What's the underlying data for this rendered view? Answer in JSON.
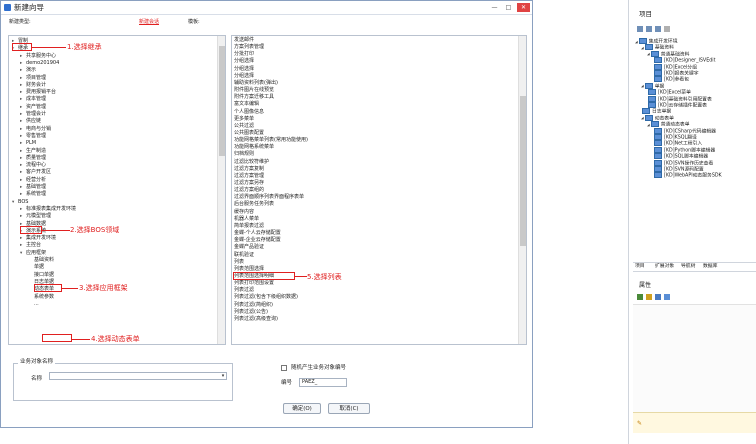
{
  "dialog": {
    "title": "新建向导",
    "create_type_label": "新建类型:",
    "tag": "新建会话",
    "template_label": "模板:"
  },
  "tree": [
    {
      "label": "冒制",
      "toggle": "▸"
    },
    {
      "label": "继承",
      "toggle": "▸"
    },
    {
      "label": "共享服务中心",
      "toggle": "▸"
    },
    {
      "label": "demo201904",
      "toggle": "▸"
    },
    {
      "label": "演示",
      "toggle": "▸"
    },
    {
      "label": "项目管理",
      "toggle": "▸"
    },
    {
      "label": "财务会计",
      "toggle": "▸"
    },
    {
      "label": "费用报销平台",
      "toggle": "▸"
    },
    {
      "label": "成本管理",
      "toggle": "▸"
    },
    {
      "label": "资产管理",
      "toggle": "▸"
    },
    {
      "label": "管理会计",
      "toggle": "▸"
    },
    {
      "label": "供应链",
      "toggle": "▸"
    },
    {
      "label": "电商与分销",
      "toggle": "▸"
    },
    {
      "label": "零售管理",
      "toggle": "▸"
    },
    {
      "label": "PLM",
      "toggle": "▸"
    },
    {
      "label": "生产制造",
      "toggle": "▸"
    },
    {
      "label": "质量管理",
      "toggle": "▸"
    },
    {
      "label": "流程中心",
      "toggle": "▸"
    },
    {
      "label": "客户开发区",
      "toggle": "▸"
    },
    {
      "label": "经营分析",
      "toggle": "▸"
    },
    {
      "label": "基础管理",
      "toggle": "▸"
    },
    {
      "label": "系统管理",
      "toggle": "▸"
    },
    {
      "label": "BOS",
      "toggle": "▾"
    },
    {
      "label": "标准报表集成开发环境",
      "toggle": "▸"
    },
    {
      "label": "元模型管理",
      "toggle": "▸"
    },
    {
      "label": "基础数据",
      "toggle": "▸"
    },
    {
      "label": "演示系统",
      "toggle": "▸"
    },
    {
      "label": "集成开发环境",
      "toggle": "▸"
    },
    {
      "label": "主控台",
      "toggle": "▸"
    },
    {
      "label": "应用框架",
      "toggle": "▾"
    },
    {
      "label": "基础资料",
      "toggle": ""
    },
    {
      "label": "单据",
      "toggle": ""
    },
    {
      "label": "接口单据",
      "toggle": ""
    },
    {
      "label": "日志单据",
      "toggle": ""
    },
    {
      "label": "动态表单",
      "toggle": ""
    },
    {
      "label": "系统参数",
      "toggle": ""
    },
    {
      "label": "...",
      "toggle": ""
    }
  ],
  "list": [
    "发送邮件",
    "方案列表管理",
    "分批打印",
    "分组选择",
    "分组选择",
    "分组选择",
    "辅助资料列表(弹出)",
    "附件图片在线预览",
    "附件方案迁移工具",
    "富文本编辑",
    "个人图像信息",
    "更多菜单",
    "公共过滤",
    "公共图表配置",
    "功能网格菜单列表(常用功能使用)",
    "功能网格系统菜单",
    "归档规则",
    "过滤比较符维护",
    "过滤方案复制",
    "过滤方案管理",
    "过滤方案另存",
    "过滤方案组的",
    "过滤界面顺序列表界面程序表单",
    "后台服务任务列表",
    "缓存内容",
    "机器人菜单",
    "简单报表过滤",
    "金蝶-个人云存储配置",
    "金蝶-企业云存储配置",
    "金蝶产品验证",
    "联机验证",
    "列表",
    "列表范围选择",
    "列表范围选择明细",
    "列表打印范围设置",
    "列表过滤",
    "列表过滤(包含下级组织数据)",
    "列表过滤(简组织)",
    "列表过滤(公告)",
    "列表过滤(高级查询)"
  ],
  "annotations": {
    "step1": "1.选择继承",
    "step2": "2.选择BOS领域",
    "step3": "3.选择应用框架",
    "step4": "4.选择动态表单",
    "step5": "5.选择列表"
  },
  "biz_group": {
    "legend": "业务对象名称",
    "name_label": "名称"
  },
  "options": {
    "random_label": "随机产生业务对象编号",
    "code_label": "编号",
    "code_value": "PAEZ_"
  },
  "buttons": {
    "ok": "确定(O)",
    "cancel": "取消(C)"
  },
  "window": {
    "min": "—",
    "max": "□",
    "close": "✕"
  },
  "ide": {
    "title": "项目",
    "tree": [
      {
        "label": "集成开发环境",
        "indent": 0,
        "toggle": "◢"
      },
      {
        "label": "基础资料",
        "indent": 1,
        "toggle": "◢"
      },
      {
        "label": "普通基础资料",
        "indent": 2,
        "toggle": "◢"
      },
      {
        "label": "[KD]Designer_ISVEdit",
        "indent": 3,
        "toggle": ""
      },
      {
        "label": "[KD]Excel分组",
        "indent": 3,
        "toggle": ""
      },
      {
        "label": "[KD]报表关键字",
        "indent": 3,
        "toggle": ""
      },
      {
        "label": "[KD]参看包",
        "indent": 3,
        "toggle": ""
      },
      {
        "label": "单据",
        "indent": 1,
        "toggle": "◢"
      },
      {
        "label": "[KD]Excel菜单",
        "indent": 2,
        "toggle": ""
      },
      {
        "label": "[KD]基础资料引用配置表",
        "indent": 2,
        "toggle": ""
      },
      {
        "label": "[KD]云存储插件配置表",
        "indent": 2,
        "toggle": ""
      },
      {
        "label": "日志单据",
        "indent": 1,
        "toggle": ""
      },
      {
        "label": "动态表单",
        "indent": 1,
        "toggle": "◢"
      },
      {
        "label": "普通动态表单",
        "indent": 2,
        "toggle": "◢"
      },
      {
        "label": "[KD]CSharp代码编辑器",
        "indent": 3,
        "toggle": ""
      },
      {
        "label": "[KD]KSQL翻译",
        "indent": 3,
        "toggle": ""
      },
      {
        "label": "[KD]Net工程引入",
        "indent": 3,
        "toggle": ""
      },
      {
        "label": "[KD]Python脚本编辑器",
        "indent": 3,
        "toggle": ""
      },
      {
        "label": "[KD]SQL脚本编辑器",
        "indent": 3,
        "toggle": ""
      },
      {
        "label": "[KD]SVN操作历史查看",
        "indent": 3,
        "toggle": ""
      },
      {
        "label": "[KD]SVN源码配置",
        "indent": 3,
        "toggle": ""
      },
      {
        "label": "[KD]WebAPI动态服务SDK",
        "indent": 3,
        "toggle": ""
      }
    ],
    "tabs": [
      "项目",
      "扩展对象",
      "导航树",
      "数据库"
    ],
    "props_title": "属性"
  }
}
